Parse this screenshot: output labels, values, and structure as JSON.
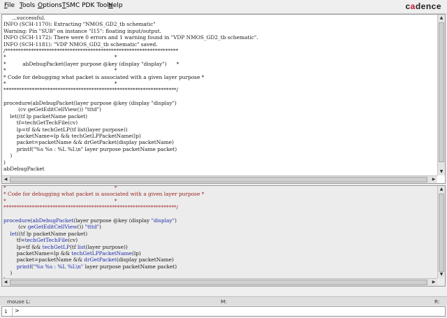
{
  "menubar": {
    "items": [
      "File",
      "Tools",
      "Options",
      "TSMC PDK Tools",
      "Help"
    ],
    "logo_prefix": "c",
    "logo_accent": "a",
    "logo_suffix": "dence"
  },
  "log_pane": {
    "lines": [
      [
        {
          "t": "     ...successful.",
          "c": "blk"
        }
      ],
      [
        {
          "t": "INFO (SCH-1170): Extracting \"NMOS_GD2_tb schematic\"",
          "c": "blk"
        }
      ],
      [
        {
          "t": "Warning: Pin \"SUB\" on instance \"I15\": floating input/output.",
          "c": "blk"
        }
      ],
      [
        {
          "t": "INFO (SCH-1172): There were 0 errors and 1 warning found in \"VDP NMOS_GD2_tb schematic\".",
          "c": "blk"
        }
      ],
      [
        {
          "t": "INFO (SCH-1181): \"VDP NMOS_GD2_tb schematic\" saved.",
          "c": "blk"
        }
      ],
      [
        {
          "t": "/*******************************************************************",
          "c": "blk"
        }
      ],
      [
        {
          "t": "*                                                                  *",
          "c": "blk"
        }
      ],
      [
        {
          "t": "*          abDebugPacket(layer purpose @key (display \"display\")      *",
          "c": "blk"
        }
      ],
      [
        {
          "t": "*                                                                  *",
          "c": "blk"
        }
      ],
      [
        {
          "t": "* Code for debugging what packet is associated with a given layer purpose *",
          "c": "blk"
        }
      ],
      [
        {
          "t": "*                                                                  *",
          "c": "blk"
        }
      ],
      [
        {
          "t": "*******************************************************************/",
          "c": "blk"
        }
      ],
      [
        {
          "t": "",
          "c": "blk"
        }
      ],
      [
        {
          "t": "procedure(abDebugPacket(layer purpose @key (display \"display\")",
          "c": "blk"
        }
      ],
      [
        {
          "t": "         (cv geGetEditCellView()) \"tttd\")",
          "c": "blk"
        }
      ],
      [
        {
          "t": "    let((tf lp packetName packet)",
          "c": "blk"
        }
      ],
      [
        {
          "t": "        tf=techGetTechFile(cv)",
          "c": "blk"
        }
      ],
      [
        {
          "t": "        lp=tf && techGetLP(tf list(layer purpose))",
          "c": "blk"
        }
      ],
      [
        {
          "t": "        packetName=lp && techGetLPPacketName(lp)",
          "c": "blk"
        }
      ],
      [
        {
          "t": "        packet=packetName && drGetPacket(display packetName)",
          "c": "blk"
        }
      ],
      [
        {
          "t": "        printf(\"%s %s : %L %L\\n\" layer purpose packetName packet)",
          "c": "blk"
        }
      ],
      [
        {
          "t": "    )",
          "c": "blk"
        }
      ],
      [
        {
          "t": ")",
          "c": "blk"
        }
      ],
      [
        {
          "t": "abDebugPacket",
          "c": "blk"
        }
      ]
    ]
  },
  "source_pane": {
    "lines": [
      [
        {
          "t": "*                                                                  *",
          "c": "red"
        }
      ],
      [
        {
          "t": "* Code for debugging what packet is associated with a given layer purpose *",
          "c": "red"
        }
      ],
      [
        {
          "t": "*                                                                  *",
          "c": "red"
        }
      ],
      [
        {
          "t": "*******************************************************************/",
          "c": "red"
        }
      ],
      [
        {
          "t": "",
          "c": "blk"
        }
      ],
      [
        {
          "t": "procedure",
          "c": "blue"
        },
        {
          "t": "(",
          "c": "blk"
        },
        {
          "t": "abDebugPacket",
          "c": "blue"
        },
        {
          "t": "(layer purpose @key (display ",
          "c": "blk"
        },
        {
          "t": "\"display\"",
          "c": "blue"
        },
        {
          "t": ")",
          "c": "blk"
        }
      ],
      [
        {
          "t": "         (cv ",
          "c": "blk"
        },
        {
          "t": "geGetEditCellView",
          "c": "blue"
        },
        {
          "t": "()) ",
          "c": "blk"
        },
        {
          "t": "\"tttd\"",
          "c": "blue"
        },
        {
          "t": ")",
          "c": "blk"
        }
      ],
      [
        {
          "t": "    ",
          "c": "blk"
        },
        {
          "t": "let",
          "c": "blue"
        },
        {
          "t": "((tf lp packetName packet)",
          "c": "blk"
        }
      ],
      [
        {
          "t": "        tf=",
          "c": "blk"
        },
        {
          "t": "techGetTechFile",
          "c": "blue"
        },
        {
          "t": "(cv)",
          "c": "blk"
        }
      ],
      [
        {
          "t": "        lp=tf && ",
          "c": "blk"
        },
        {
          "t": "techGetLP",
          "c": "blue"
        },
        {
          "t": "(tf ",
          "c": "blk"
        },
        {
          "t": "list",
          "c": "blue"
        },
        {
          "t": "(layer purpose))",
          "c": "blk"
        }
      ],
      [
        {
          "t": "        packetName=lp && ",
          "c": "blk"
        },
        {
          "t": "techGetLPPacketName",
          "c": "blue"
        },
        {
          "t": "(lp)",
          "c": "blk"
        }
      ],
      [
        {
          "t": "        packet=packetName && ",
          "c": "blk"
        },
        {
          "t": "drGetPacket",
          "c": "blue"
        },
        {
          "t": "(display packetName)",
          "c": "blk"
        }
      ],
      [
        {
          "t": "        ",
          "c": "blk"
        },
        {
          "t": "printf",
          "c": "blue"
        },
        {
          "t": "(",
          "c": "blk"
        },
        {
          "t": "\"%s %s : %L %L\\n\"",
          "c": "blue"
        },
        {
          "t": " layer purpose packetName packet)",
          "c": "blk"
        }
      ],
      [
        {
          "t": "    )",
          "c": "blk"
        }
      ],
      [
        {
          "t": ")",
          "c": "blk"
        }
      ]
    ]
  },
  "statusbar": {
    "mouse_left": "mouse L:",
    "mouse_middle": "M:",
    "mouse_right": "R:"
  },
  "cmdline": {
    "number": "1",
    "prompt": ">",
    "value": ""
  },
  "colors": {
    "comment_red": "#9b2323",
    "keyword_blue": "#1f2ea8",
    "logo_accent": "#c8102e"
  }
}
